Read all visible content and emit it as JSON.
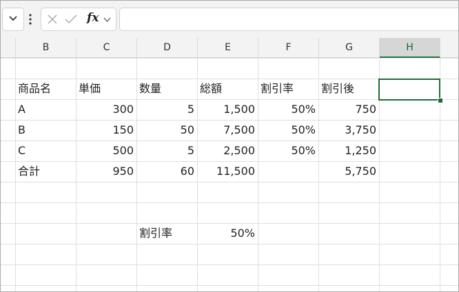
{
  "formula_bar": {
    "formula_value": "",
    "fx_label": "fx"
  },
  "columns": [
    "B",
    "C",
    "D",
    "E",
    "F",
    "G",
    "H"
  ],
  "selected_column": "H",
  "table": {
    "headers": [
      "商品名",
      "単価",
      "数量",
      "総額",
      "割引率",
      "割引後"
    ],
    "rows": [
      [
        "A",
        "300",
        "5",
        "1,500",
        "50%",
        "750"
      ],
      [
        "B",
        "150",
        "50",
        "7,500",
        "50%",
        "3,750"
      ],
      [
        "C",
        "500",
        "5",
        "2,500",
        "50%",
        "1,250"
      ],
      [
        "合計",
        "950",
        "60",
        "11,500",
        "",
        "5,750"
      ]
    ]
  },
  "discount_box": {
    "label": "割引率",
    "value": "50%"
  },
  "colors": {
    "selection_green": "#1e6b36",
    "header_bg": "#f3f3f3",
    "gridline": "#dedede"
  }
}
